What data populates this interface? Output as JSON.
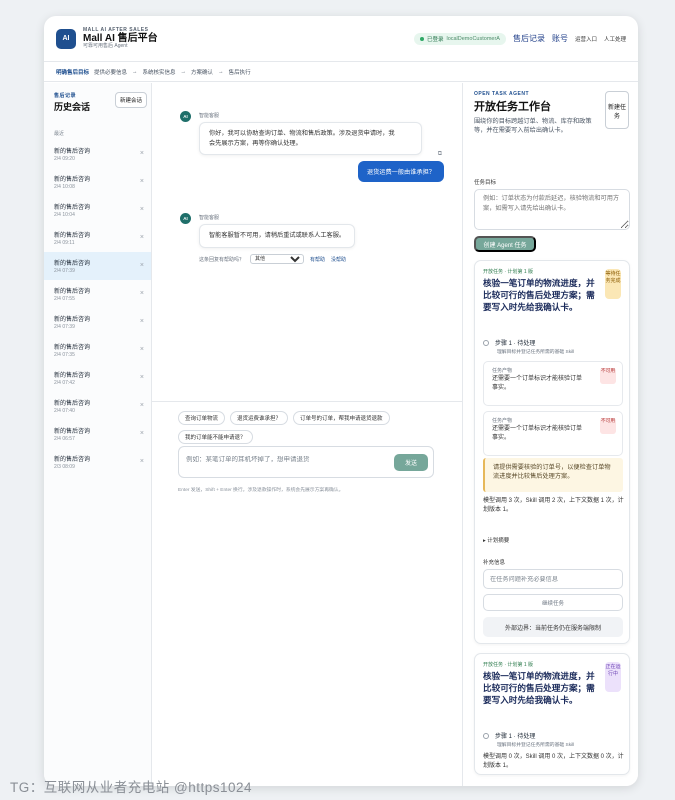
{
  "header": {
    "small": "MALL AI AFTER SALES",
    "title": "Mall AI 售后平台",
    "subtitle": "可靠可用售后 Agent",
    "logo": "AI",
    "status": "已登录",
    "user": "localDemoCustomerA",
    "nav_after_sales": "售后记录",
    "nav_account": "账号",
    "nav_ops": "运营入口",
    "nav_human": "人工处理"
  },
  "breadcrumb": [
    "明确售后目标",
    "提供必要信息",
    "→",
    "系统核实信息",
    "→",
    "方案确认",
    "→",
    "售后执行"
  ],
  "sidebar": {
    "small": "售后记录",
    "title": "历史会话",
    "new_button": "新建会话",
    "section": "最近",
    "items": [
      {
        "title": "新的售后咨询",
        "date": "2/4 09:20"
      },
      {
        "title": "新的售后咨询",
        "date": "2/4 10:08"
      },
      {
        "title": "新的售后咨询",
        "date": "2/4 10:04"
      },
      {
        "title": "新的售后咨询",
        "date": "2/4 09:11"
      },
      {
        "title": "新的售后咨询",
        "date": "2/4 07:39"
      },
      {
        "title": "新的售后咨询",
        "date": "2/4 07:55"
      },
      {
        "title": "新的售后咨询",
        "date": "2/4 07:39"
      },
      {
        "title": "新的售后咨询",
        "date": "2/4 07:35"
      },
      {
        "title": "新的售后咨询",
        "date": "2/4 07:42"
      },
      {
        "title": "新的售后咨询",
        "date": "2/4 07:40"
      },
      {
        "title": "新的售后咨询",
        "date": "2/4 06:57"
      },
      {
        "title": "新的售后咨询",
        "date": "2/3 08:09"
      }
    ]
  },
  "chat": {
    "bot_name": "智能客服",
    "avatar": "AI",
    "welcome_line1": "你好，我可以协助查询订单、物流和售后政策。涉及退货申请时，我",
    "welcome_line2": "会先展示方案，再等你确认处理。",
    "user_message": "退货运费一般由谁承担？",
    "copy_icon": "copy-icon",
    "reply": "智能客服暂不可用，请稍后重试或联系人工客服。",
    "feedback_label": "这条回复有帮助吗？",
    "feedback_select": "其他",
    "feedback_helpful": "有帮助",
    "feedback_not_helpful": "没帮助"
  },
  "composer": {
    "chips": [
      "查询订单物流",
      "退货运费谁承担？",
      "订单号的订单，帮我申请退货退款",
      "我的订单能不能申请退？"
    ],
    "placeholder": "例如：某笔订单的耳机坏掉了，想申请退货",
    "send": "发送",
    "hint": "Enter 发送，Shift + Enter 换行。涉及退款操作时，系统会先展示方案再确认。"
  },
  "task": {
    "small": "OPEN TASK AGENT",
    "title": "开放任务工作台",
    "desc": "围绕你的目标跨越订单、物流、库存和政策等，并在需要写入前给出确认卡。",
    "new_button": "新建任务",
    "goal_label": "任务目标",
    "goal_placeholder": "例如：订单状态为付款后延迟，核验物流和可用方案，如需写入请先给出确认卡。",
    "create_button": "创建 Agent 任务",
    "cards": [
      {
        "small": "开放任务 · 计划第 1 版",
        "title": "核验一笔订单的物流进度，并比较可行的售后处理方案；需要写入时先给我确认卡。",
        "badge": "等待任务完成",
        "step": "步骤 1 · 待处理",
        "step_sub": "理解目标并登记任务所需的基础 Skill",
        "sub1_label": "任务产物",
        "sub1_text": "还需要一个订单标识才能核验订单事实。",
        "sub1_tag": "不可用",
        "sub2_label": "任务产物",
        "sub2_text": "还需要一个订单标识才能核验订单事实。",
        "sub2_tag": "不可用",
        "warn": "请提供需要核验的订单号，以便检查订单物流进度并比较售后处理方案。",
        "stats": "模型调用 3 次，Skill 调用 2 次，上下文数据 1 次，计划版本 1。",
        "expand": "▸ 计划摘要",
        "supp_label": "补充信息",
        "supp_placeholder": "在任务问题补充必要信息",
        "continue": "继续任务",
        "boundary": "外部边界：当前任务仍在服务端限制"
      },
      {
        "small": "开放任务 · 计划第 1 版",
        "title": "核验一笔订单的物流进度，并比较可行的售后处理方案；需要写入时先给我确认卡。",
        "badge": "正在运行中",
        "step": "步骤 1 · 待处理",
        "step_sub": "理解目标并登记任务所需的基础 Skill",
        "stats": "模型调用 0 次，Skill 调用 0 次，上下文数据 0 次，计划版本 1。"
      }
    ]
  },
  "watermark": "TG：互联网从业者充电站 @https1024"
}
